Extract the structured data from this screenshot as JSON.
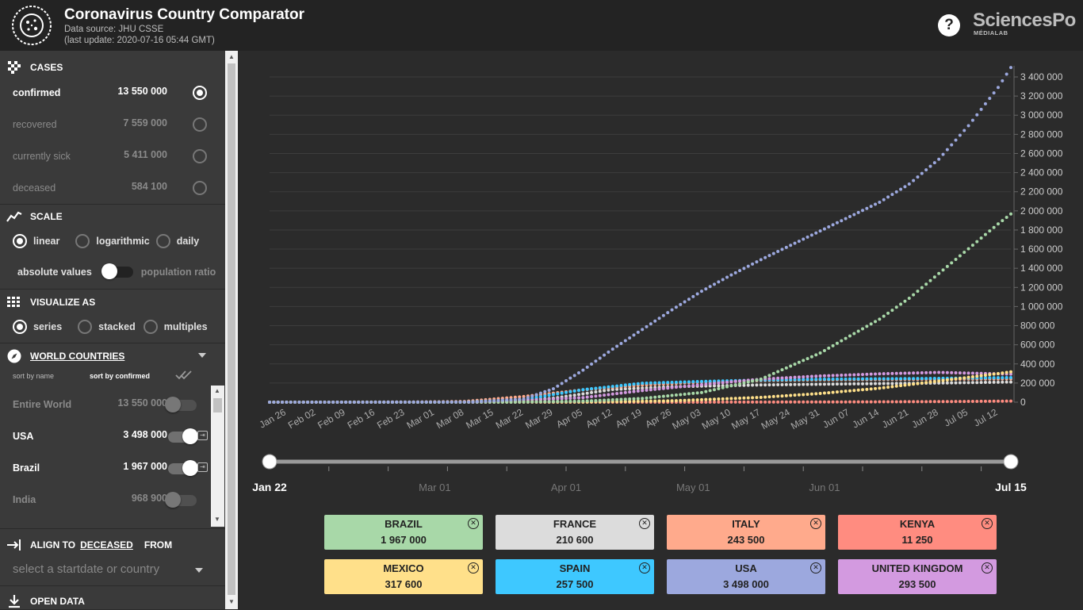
{
  "header": {
    "title": "Coronavirus Country Comparator",
    "source": "Data source: JHU CSSE",
    "update": "(last update: 2020-07-16 05:44 GMT)",
    "help": "?",
    "brand": "SciencesPo",
    "brand_sub": "MÉDIALAB"
  },
  "sidebar": {
    "cases": {
      "title": "CASES",
      "rows": [
        {
          "label": "confirmed",
          "value": "13 550 000",
          "selected": true
        },
        {
          "label": "recovered",
          "value": "7 559 000",
          "selected": false
        },
        {
          "label": "currently sick",
          "value": "5 411 000",
          "selected": false
        },
        {
          "label": "deceased",
          "value": "584 100",
          "selected": false
        }
      ]
    },
    "scale": {
      "title": "SCALE",
      "options": [
        "linear",
        "logarithmic",
        "daily"
      ],
      "selected": "linear",
      "abs_label": "absolute values",
      "ratio_label": "population ratio"
    },
    "visualize": {
      "title": "VISUALIZE AS",
      "options": [
        "series",
        "stacked",
        "multiples"
      ],
      "selected": "series"
    },
    "countries": {
      "title": "WORLD COUNTRIES",
      "sort_name": "sort by name",
      "sort_confirmed": "sort by confirmed",
      "rows": [
        {
          "label": "Entire World",
          "value": "13 550 000",
          "on": false
        },
        {
          "label": "USA",
          "value": "3 498 000",
          "on": true
        },
        {
          "label": "Brazil",
          "value": "1 967 000",
          "on": true
        },
        {
          "label": "India",
          "value": "968 900",
          "on": false
        }
      ]
    },
    "align": {
      "prefix": "ALIGN TO",
      "target": "DECEASED",
      "suffix": "FROM",
      "placeholder": "select a startdate or country"
    },
    "open_data": "OPEN DATA"
  },
  "slider": {
    "start": "Jan 22",
    "end": "Jul 15",
    "marks": [
      "Mar 01",
      "Apr 01",
      "May 01",
      "Jun 01"
    ]
  },
  "legend": [
    {
      "name": "BRAZIL",
      "value": "1 967 000",
      "color": "#a8d8a8"
    },
    {
      "name": "FRANCE",
      "value": "210 600",
      "color": "#dcdcdc"
    },
    {
      "name": "ITALY",
      "value": "243 500",
      "color": "#ffaa8c"
    },
    {
      "name": "KENYA",
      "value": "11 250",
      "color": "#ff8c80"
    },
    {
      "name": "MEXICO",
      "value": "317 600",
      "color": "#ffe08a"
    },
    {
      "name": "SPAIN",
      "value": "257 500",
      "color": "#3ec8ff"
    },
    {
      "name": "USA",
      "value": "3 498 000",
      "color": "#9ca8de"
    },
    {
      "name": "UNITED KINGDOM",
      "value": "293 500",
      "color": "#d39ae0"
    }
  ],
  "chart_data": {
    "type": "line",
    "x_labels": [
      "Jan 26",
      "Feb 02",
      "Feb 09",
      "Feb 16",
      "Feb 23",
      "Mar 01",
      "Mar 08",
      "Mar 15",
      "Mar 22",
      "Mar 29",
      "Apr 05",
      "Apr 12",
      "Apr 19",
      "Apr 26",
      "May 03",
      "May 10",
      "May 17",
      "May 24",
      "May 31",
      "Jun 07",
      "Jun 14",
      "Jun 21",
      "Jun 28",
      "Jul 05",
      "Jul 12"
    ],
    "y_ticks": [
      "0",
      "200 000",
      "400 000",
      "600 000",
      "800 000",
      "1 000 000",
      "1 200 000",
      "1 400 000",
      "1 600 000",
      "1 800 000",
      "2 000 000",
      "2 200 000",
      "2 400 000",
      "2 600 000",
      "2 800 000",
      "3 000 000",
      "3 200 000",
      "3 400 000"
    ],
    "ylim": [
      0,
      3400000
    ],
    "x_days": [
      "2020-01-22",
      "2020-07-15"
    ],
    "series": [
      {
        "name": "USA",
        "color": "#9ca8de",
        "points": [
          [
            "2020-01-22",
            0
          ],
          [
            "2020-03-10",
            1000
          ],
          [
            "2020-03-22",
            33000
          ],
          [
            "2020-03-29",
            140000
          ],
          [
            "2020-04-05",
            335000
          ],
          [
            "2020-04-12",
            555000
          ],
          [
            "2020-04-19",
            760000
          ],
          [
            "2020-04-26",
            965000
          ],
          [
            "2020-05-03",
            1160000
          ],
          [
            "2020-05-10",
            1330000
          ],
          [
            "2020-05-17",
            1490000
          ],
          [
            "2020-05-24",
            1640000
          ],
          [
            "2020-05-31",
            1790000
          ],
          [
            "2020-06-07",
            1940000
          ],
          [
            "2020-06-14",
            2090000
          ],
          [
            "2020-06-21",
            2280000
          ],
          [
            "2020-06-28",
            2540000
          ],
          [
            "2020-07-05",
            2890000
          ],
          [
            "2020-07-12",
            3290000
          ],
          [
            "2020-07-15",
            3498000
          ]
        ]
      },
      {
        "name": "BRAZIL",
        "color": "#a8d8a8",
        "points": [
          [
            "2020-01-22",
            0
          ],
          [
            "2020-03-20",
            0
          ],
          [
            "2020-04-05",
            11000
          ],
          [
            "2020-04-19",
            39000
          ],
          [
            "2020-05-03",
            101000
          ],
          [
            "2020-05-17",
            241000
          ],
          [
            "2020-05-31",
            514000
          ],
          [
            "2020-06-07",
            692000
          ],
          [
            "2020-06-14",
            868000
          ],
          [
            "2020-06-21",
            1086000
          ],
          [
            "2020-06-28",
            1345000
          ],
          [
            "2020-07-05",
            1604000
          ],
          [
            "2020-07-12",
            1864000
          ],
          [
            "2020-07-15",
            1967000
          ]
        ]
      },
      {
        "name": "MEXICO",
        "color": "#ffe08a",
        "points": [
          [
            "2020-01-22",
            0
          ],
          [
            "2020-04-05",
            2000
          ],
          [
            "2020-04-26",
            14000
          ],
          [
            "2020-05-17",
            50000
          ],
          [
            "2020-05-31",
            91000
          ],
          [
            "2020-06-14",
            146000
          ],
          [
            "2020-06-28",
            221000
          ],
          [
            "2020-07-12",
            299000
          ],
          [
            "2020-07-15",
            317600
          ]
        ]
      },
      {
        "name": "UNITED KINGDOM",
        "color": "#d39ae0",
        "points": [
          [
            "2020-01-22",
            0
          ],
          [
            "2020-03-15",
            1000
          ],
          [
            "2020-04-05",
            48000
          ],
          [
            "2020-04-19",
            121000
          ],
          [
            "2020-05-03",
            183000
          ],
          [
            "2020-05-17",
            241000
          ],
          [
            "2020-05-31",
            274000
          ],
          [
            "2020-06-14",
            296000
          ],
          [
            "2020-06-28",
            311000
          ],
          [
            "2020-07-15",
            293500
          ]
        ]
      },
      {
        "name": "SPAIN",
        "color": "#3ec8ff",
        "points": [
          [
            "2020-01-22",
            0
          ],
          [
            "2020-03-08",
            600
          ],
          [
            "2020-03-22",
            28000
          ],
          [
            "2020-04-05",
            131000
          ],
          [
            "2020-04-19",
            198000
          ],
          [
            "2020-05-03",
            217000
          ],
          [
            "2020-05-17",
            231000
          ],
          [
            "2020-05-31",
            240000
          ],
          [
            "2020-06-28",
            249000
          ],
          [
            "2020-07-15",
            257500
          ]
        ]
      },
      {
        "name": "ITALY",
        "color": "#ffaa8c",
        "points": [
          [
            "2020-01-22",
            0
          ],
          [
            "2020-02-23",
            150
          ],
          [
            "2020-03-08",
            7400
          ],
          [
            "2020-03-22",
            59000
          ],
          [
            "2020-04-05",
            129000
          ],
          [
            "2020-04-19",
            179000
          ],
          [
            "2020-05-03",
            211000
          ],
          [
            "2020-05-17",
            225000
          ],
          [
            "2020-05-31",
            233000
          ],
          [
            "2020-06-28",
            240000
          ],
          [
            "2020-07-15",
            243500
          ]
        ]
      },
      {
        "name": "FRANCE",
        "color": "#dcdcdc",
        "points": [
          [
            "2020-01-22",
            0
          ],
          [
            "2020-03-01",
            130
          ],
          [
            "2020-03-15",
            5400
          ],
          [
            "2020-03-29",
            41000
          ],
          [
            "2020-04-12",
            133000
          ],
          [
            "2020-04-26",
            162000
          ],
          [
            "2020-05-17",
            180000
          ],
          [
            "2020-06-07",
            191000
          ],
          [
            "2020-06-28",
            200000
          ],
          [
            "2020-07-15",
            210600
          ]
        ]
      },
      {
        "name": "KENYA",
        "color": "#ff8c80",
        "points": [
          [
            "2020-01-22",
            0
          ],
          [
            "2020-03-15",
            1
          ],
          [
            "2020-05-03",
            400
          ],
          [
            "2020-06-07",
            2600
          ],
          [
            "2020-07-01",
            6700
          ],
          [
            "2020-07-15",
            11250
          ]
        ]
      }
    ]
  }
}
